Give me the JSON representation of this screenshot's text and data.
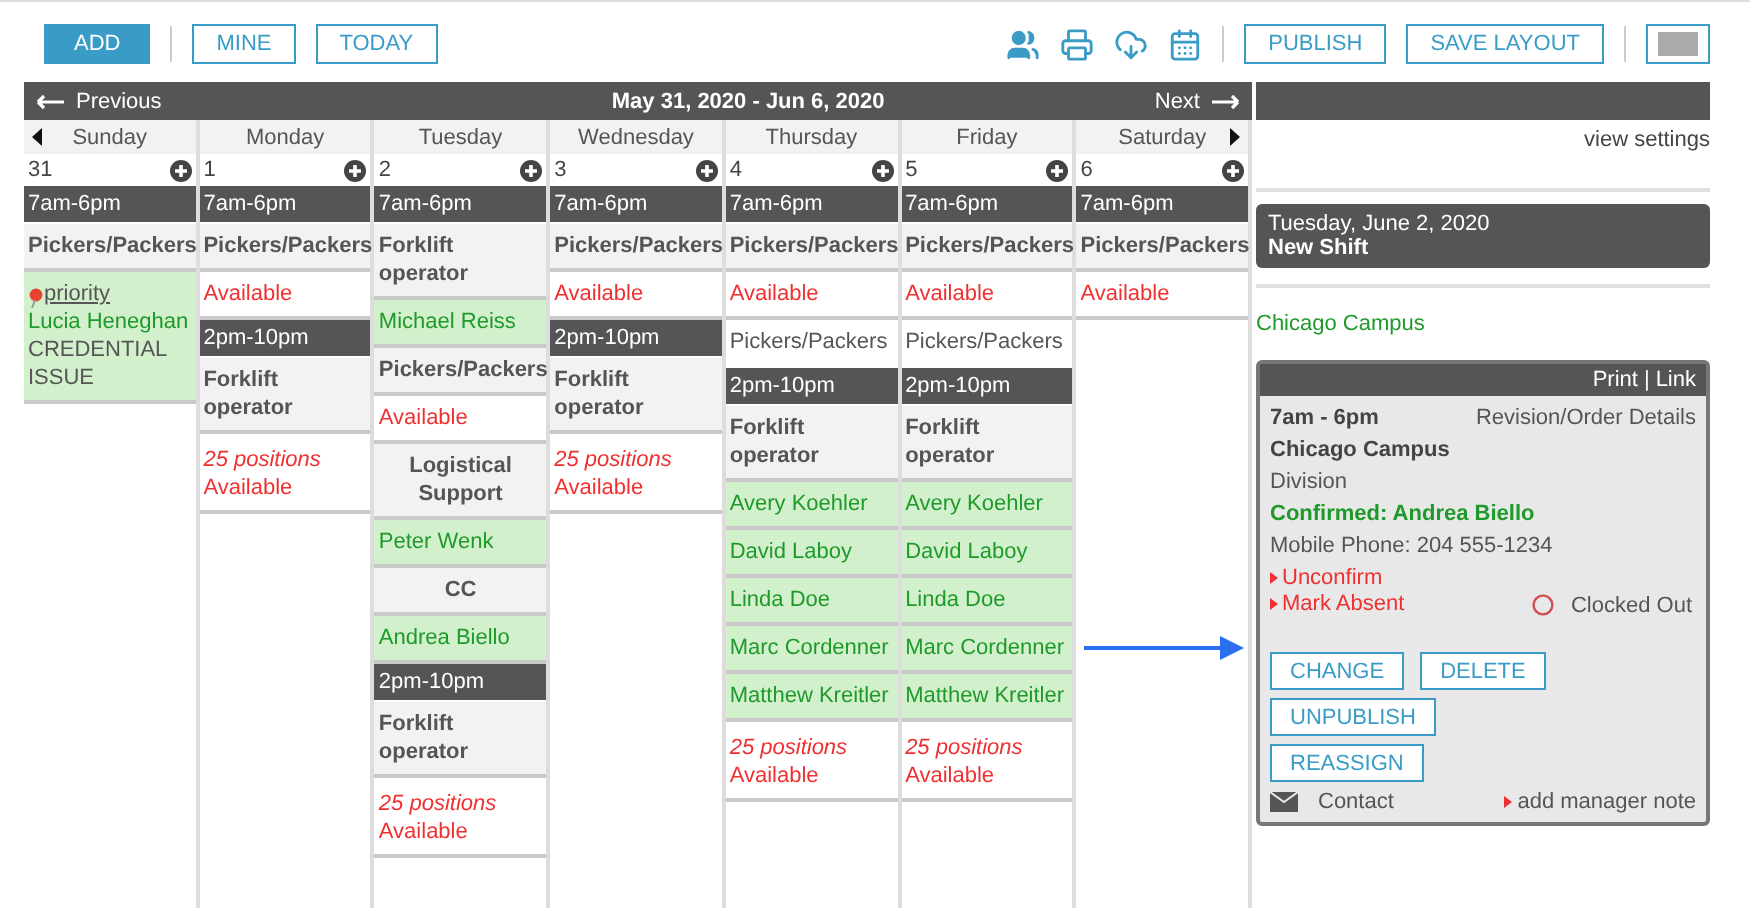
{
  "toolbar": {
    "left_buttons": [
      {
        "label": "ADD",
        "kind": "primary"
      },
      {
        "label": "MINE",
        "kind": "outline"
      },
      {
        "label": "TODAY",
        "kind": "outline"
      }
    ],
    "right_buttons": [
      "PUBLISH",
      "SAVE LAYOUT"
    ]
  },
  "nav": {
    "previous": "Previous",
    "range": "May 31, 2020 - Jun 6, 2020",
    "next": "Next"
  },
  "days": [
    {
      "name": "Sunday",
      "date": "31",
      "blocks": [
        {
          "kind": "time",
          "text": "7am-6pm"
        },
        {
          "kind": "role",
          "text": "Pickers/Packers"
        },
        {
          "kind": "flagged",
          "flag": "priority",
          "name": "Lucia Heneghan",
          "note": "CREDENTIAL ISSUE"
        }
      ]
    },
    {
      "name": "Monday",
      "date": "1",
      "blocks": [
        {
          "kind": "time",
          "text": "7am-6pm"
        },
        {
          "kind": "role",
          "text": "Pickers/Packers"
        },
        {
          "kind": "available",
          "text": "Available"
        },
        {
          "kind": "time",
          "text": "2pm-10pm"
        },
        {
          "kind": "role",
          "text": "Forklift operator"
        },
        {
          "kind": "open",
          "count": "25 positions",
          "text": "Available"
        }
      ]
    },
    {
      "name": "Tuesday",
      "date": "2",
      "blocks": [
        {
          "kind": "time",
          "text": "7am-6pm"
        },
        {
          "kind": "role",
          "text": "Forklift operator"
        },
        {
          "kind": "assigned",
          "text": "Michael Reiss"
        },
        {
          "kind": "role",
          "text": "Pickers/Packers"
        },
        {
          "kind": "available",
          "text": "Available"
        },
        {
          "kind": "group",
          "text": "Logistical Support"
        },
        {
          "kind": "assigned",
          "text": "Peter Wenk"
        },
        {
          "kind": "group",
          "text": "CC"
        },
        {
          "kind": "assigned",
          "text": "Andrea Biello"
        },
        {
          "kind": "time",
          "text": "2pm-10pm"
        },
        {
          "kind": "role",
          "text": "Forklift operator"
        },
        {
          "kind": "open",
          "count": "25 positions",
          "text": "Available"
        }
      ]
    },
    {
      "name": "Wednesday",
      "date": "3",
      "blocks": [
        {
          "kind": "time",
          "text": "7am-6pm"
        },
        {
          "kind": "role",
          "text": "Pickers/Packers"
        },
        {
          "kind": "available",
          "text": "Available"
        },
        {
          "kind": "time",
          "text": "2pm-10pm"
        },
        {
          "kind": "role",
          "text": "Forklift operator"
        },
        {
          "kind": "open",
          "count": "25 positions",
          "text": "Available"
        }
      ]
    },
    {
      "name": "Thursday",
      "date": "4",
      "blocks": [
        {
          "kind": "time",
          "text": "7am-6pm"
        },
        {
          "kind": "role",
          "text": "Pickers/Packers"
        },
        {
          "kind": "available",
          "text": "Available"
        },
        {
          "kind": "subrole",
          "text": "Pickers/Packers"
        },
        {
          "kind": "time",
          "text": "2pm-10pm"
        },
        {
          "kind": "role",
          "text": "Forklift operator"
        },
        {
          "kind": "assigned",
          "text": "Avery Koehler"
        },
        {
          "kind": "assigned",
          "text": "David Laboy"
        },
        {
          "kind": "assigned",
          "text": "Linda Doe"
        },
        {
          "kind": "assigned",
          "text": "Marc Cordenner"
        },
        {
          "kind": "assigned",
          "text": "Matthew Kreitler"
        },
        {
          "kind": "open",
          "count": "25 positions",
          "text": "Available"
        }
      ]
    },
    {
      "name": "Friday",
      "date": "5",
      "blocks": [
        {
          "kind": "time",
          "text": "7am-6pm"
        },
        {
          "kind": "role",
          "text": "Pickers/Packers"
        },
        {
          "kind": "available",
          "text": "Available"
        },
        {
          "kind": "subrole",
          "text": "Pickers/Packers"
        },
        {
          "kind": "time",
          "text": "2pm-10pm"
        },
        {
          "kind": "role",
          "text": "Forklift operator"
        },
        {
          "kind": "assigned",
          "text": "Avery Koehler"
        },
        {
          "kind": "assigned",
          "text": "David Laboy"
        },
        {
          "kind": "assigned",
          "text": "Linda Doe"
        },
        {
          "kind": "assigned",
          "text": "Marc Cordenner"
        },
        {
          "kind": "assigned",
          "text": "Matthew Kreitler"
        },
        {
          "kind": "open",
          "count": "25 positions",
          "text": "Available"
        }
      ]
    },
    {
      "name": "Saturday",
      "date": "6",
      "blocks": [
        {
          "kind": "time",
          "text": "7am-6pm"
        },
        {
          "kind": "role",
          "text": "Pickers/Packers"
        },
        {
          "kind": "available",
          "text": "Available"
        }
      ]
    }
  ],
  "side_panel": {
    "view_settings": "view settings",
    "header": {
      "date": "Tuesday, June 2, 2020",
      "title": "New Shift"
    },
    "location": "Chicago Campus",
    "card": {
      "links": [
        "Print",
        "Link"
      ],
      "separator": "|",
      "time": "7am - 6pm",
      "details_link": "Revision/Order Details",
      "site": "Chicago Campus",
      "division": "Division",
      "confirmed": "Confirmed: Andrea Biello",
      "phone": "Mobile Phone: 204 555-1234",
      "actions": [
        "Unconfirm",
        "Mark Absent"
      ],
      "clock_status": "Clocked Out",
      "button_rows": [
        [
          "CHANGE",
          "DELETE"
        ],
        [
          "UNPUBLISH"
        ],
        [
          "REASSIGN"
        ]
      ],
      "contact": "Contact",
      "note_link": "add manager note"
    }
  }
}
